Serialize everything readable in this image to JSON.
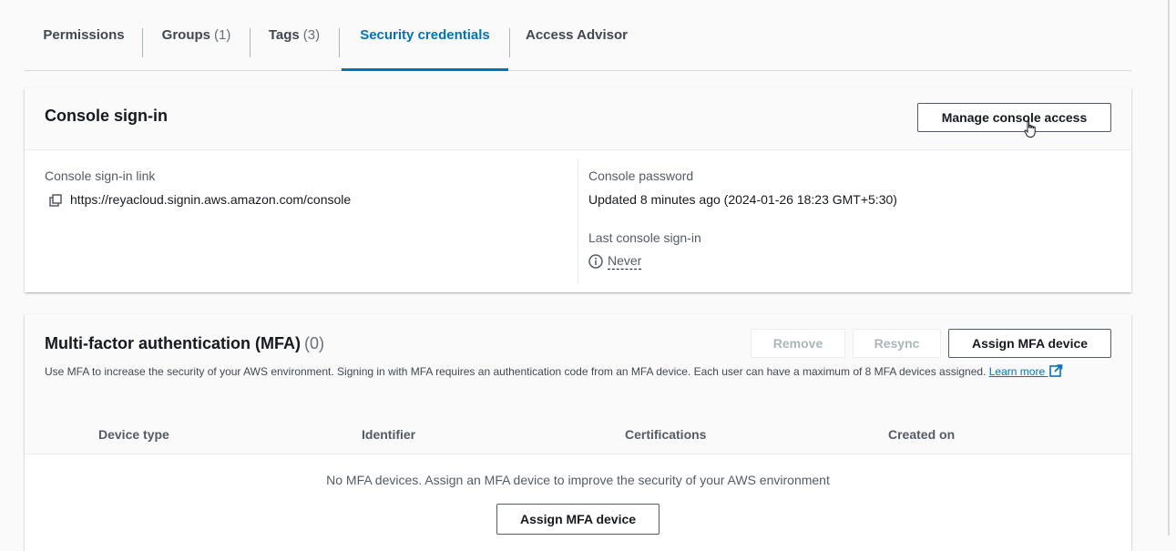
{
  "tabs": [
    {
      "label": "Permissions",
      "count": ""
    },
    {
      "label": "Groups",
      "count": "(1)"
    },
    {
      "label": "Tags",
      "count": "(3)"
    },
    {
      "label": "Security credentials",
      "count": ""
    },
    {
      "label": "Access Advisor",
      "count": ""
    }
  ],
  "active_tab": "Security credentials",
  "console_signin": {
    "title": "Console sign-in",
    "manage_button": "Manage console access",
    "link_label": "Console sign-in link",
    "link_value": "https://reyacloud.signin.aws.amazon.com/console",
    "password_label": "Console password",
    "password_value": "Updated 8 minutes ago (2024-01-26 18:23 GMT+5:30)",
    "last_signin_label": "Last console sign-in",
    "last_signin_value": "Never"
  },
  "mfa": {
    "title": "Multi-factor authentication (MFA)",
    "count": "(0)",
    "remove_button": "Remove",
    "resync_button": "Resync",
    "assign_button": "Assign MFA device",
    "description": "Use MFA to increase the security of your AWS environment. Signing in with MFA requires an authentication code from an MFA device. Each user can have a maximum of 8 MFA devices assigned.",
    "learn_more": "Learn more",
    "columns": [
      "Device type",
      "Identifier",
      "Certifications",
      "Created on"
    ],
    "empty_message": "No MFA devices. Assign an MFA device to improve the security of your AWS environment",
    "empty_assign_button": "Assign MFA device"
  },
  "colors": {
    "accent": "#0073bb",
    "text": "#16191f",
    "muted": "#545b64"
  }
}
